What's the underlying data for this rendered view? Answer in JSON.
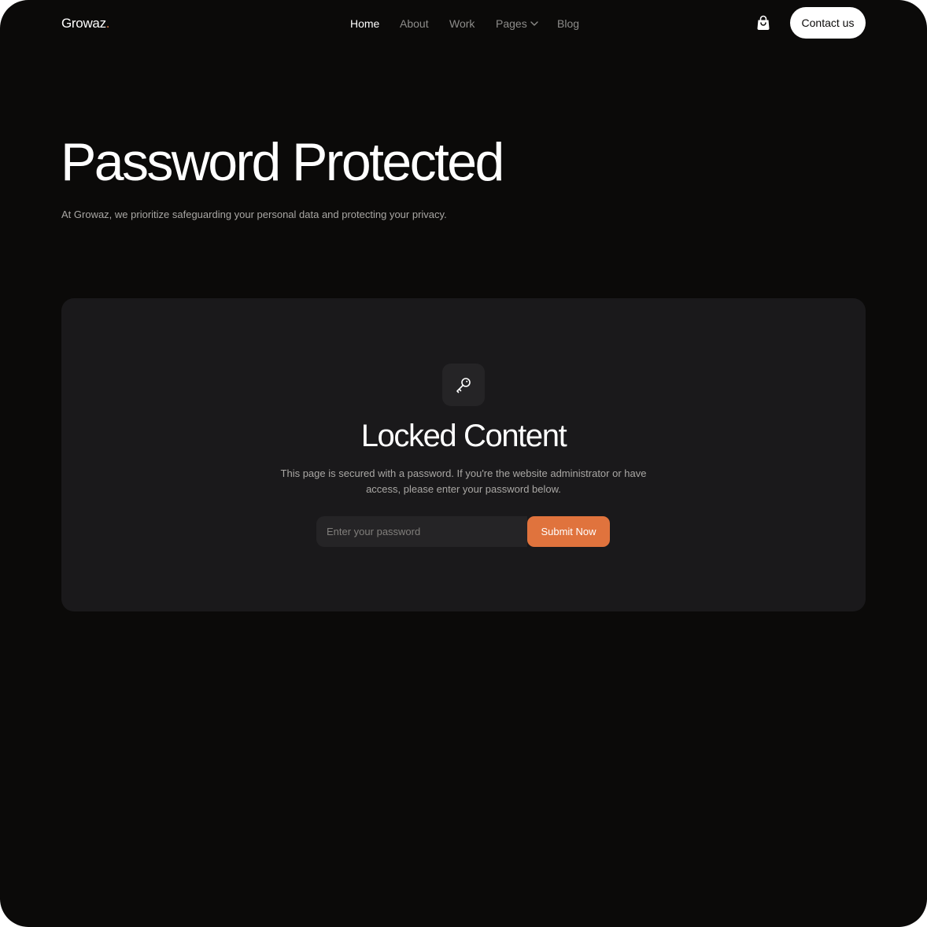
{
  "header": {
    "logo": {
      "text": "Growaz",
      "dot": "."
    },
    "nav": [
      {
        "label": "Home",
        "active": true
      },
      {
        "label": "About",
        "active": false
      },
      {
        "label": "Work",
        "active": false
      },
      {
        "label": "Pages",
        "active": false,
        "has_dropdown": true
      },
      {
        "label": "Blog",
        "active": false
      }
    ],
    "cart_icon": "shopping-bag-icon",
    "contact_label": "Contact us"
  },
  "hero": {
    "title": "Password Protected",
    "subtitle": "At Growaz, we prioritize safeguarding your personal data and protecting your privacy."
  },
  "locked": {
    "icon": "key-icon",
    "title": "Locked Content",
    "description": "This page is secured with a password. If you're the website administrator or have access, please enter your password below.",
    "input_placeholder": "Enter your password",
    "input_value": "",
    "submit_label": "Submit Now"
  },
  "colors": {
    "background": "#0b0a09",
    "card": "#1a191b",
    "accent": "#e0733d",
    "text_primary": "#ffffff",
    "text_muted": "#a9a7a4"
  }
}
